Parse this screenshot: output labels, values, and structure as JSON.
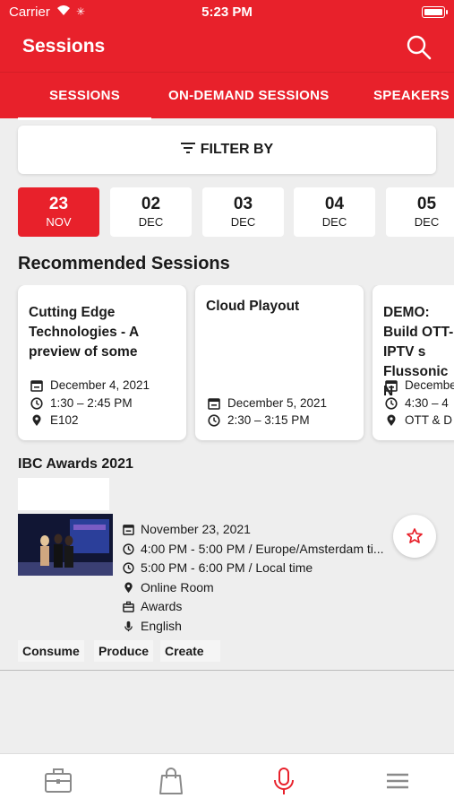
{
  "status_bar": {
    "carrier": "Carrier",
    "time": "5:23 PM"
  },
  "header": {
    "title": "Sessions",
    "search_icon": "search-icon"
  },
  "tabs": [
    {
      "label": "SESSIONS",
      "active": true
    },
    {
      "label": "ON-DEMAND SESSIONS",
      "active": false
    },
    {
      "label": "SPEAKERS",
      "active": false
    }
  ],
  "filter": {
    "label": "FILTER BY"
  },
  "dates": [
    {
      "day": "23",
      "month": "NOV",
      "selected": true
    },
    {
      "day": "02",
      "month": "DEC",
      "selected": false
    },
    {
      "day": "03",
      "month": "DEC",
      "selected": false
    },
    {
      "day": "04",
      "month": "DEC",
      "selected": false
    },
    {
      "day": "05",
      "month": "DEC",
      "selected": false
    }
  ],
  "recommended": {
    "title": "Recommended Sessions",
    "cards": [
      {
        "title": " Cutting Edge Technologies - A preview of some",
        "date": "December 4, 2021",
        "time": "1:30 – 2:45 PM",
        "location": "E102"
      },
      {
        "title": "Cloud Playout",
        "date": "December 5, 2021",
        "time": "2:30 – 3:15 PM"
      },
      {
        "title": "DEMO: Build OTT-IPTV s Flussonic N",
        "date": "December",
        "time": "4:30 – 4",
        "location": "OTT & D"
      }
    ]
  },
  "award": {
    "title": "IBC Awards 2021",
    "date": "November 23, 2021",
    "time_event": "4:00 PM - 5:00 PM / Europe/Amsterdam ti...",
    "time_local": "5:00 PM - 6:00 PM / Local time",
    "room": "Online Room",
    "category": "Awards",
    "language": "English",
    "tags": [
      "Consume",
      "Produce",
      "Create"
    ]
  },
  "colors": {
    "accent": "#e8212b"
  },
  "bottom_tabs": [
    "briefcase-icon",
    "shopping-bag-icon",
    "microphone-icon",
    "menu-icon"
  ]
}
